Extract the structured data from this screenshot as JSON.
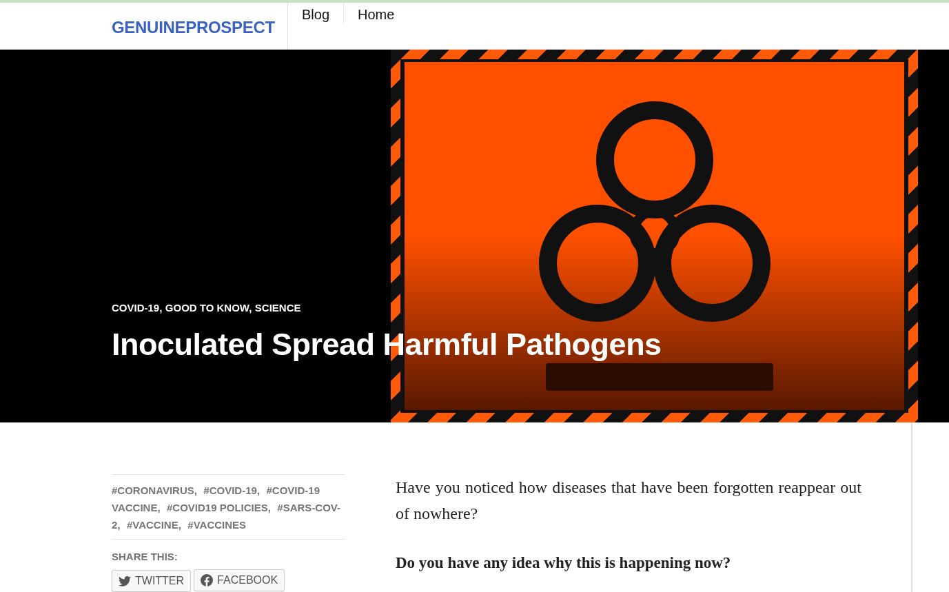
{
  "site": {
    "logo": "GENUINEPROSPECT"
  },
  "nav": [
    {
      "label": "Blog"
    },
    {
      "label": "Home"
    }
  ],
  "hero": {
    "kind": "picture",
    "categories": [
      "COVID-19,",
      "GOOD TO KNOW,",
      "SCIENCE"
    ],
    "title": "Inoculated Spread Harmful Pathogens"
  },
  "tags": [
    "#CORONAVIRUS,",
    "#COVID-19,",
    "#COVID-19",
    "VACCINE,",
    "#COVID19 POLICIES,",
    "#SARS-COV-",
    "2,",
    "#VACCINE,",
    "#VACCINES"
  ],
  "share": {
    "heading": "SHARE THIS:",
    "buttons": [
      {
        "kind": "twitter",
        "label": "TWITTER"
      },
      {
        "kind": "facebook",
        "label": "FACEBOOK"
      }
    ]
  },
  "article": {
    "paragraphs": [
      {
        "kind": "plain",
        "text": "Have you noticed how diseases that have been forgotten reappear out of nowhere?"
      },
      {
        "kind": "bold",
        "text": "Do you have any idea why this is happening now?"
      }
    ]
  }
}
